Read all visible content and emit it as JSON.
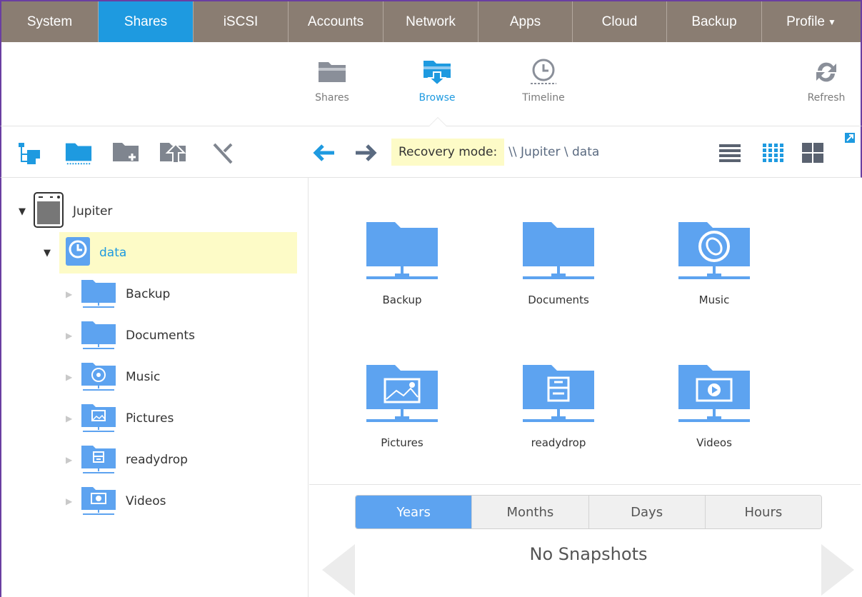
{
  "nav": {
    "tabs": [
      {
        "label": "System"
      },
      {
        "label": "Shares"
      },
      {
        "label": "iSCSI"
      },
      {
        "label": "Accounts"
      },
      {
        "label": "Network"
      },
      {
        "label": "Apps"
      },
      {
        "label": "Cloud"
      },
      {
        "label": "Backup"
      },
      {
        "label": "Profile"
      }
    ],
    "active_tab": "Shares"
  },
  "subnav": {
    "shares": "Shares",
    "browse": "Browse",
    "timeline": "Timeline",
    "refresh": "Refresh"
  },
  "toolbar": {
    "recovery_label": "Recovery mode:",
    "path": "\\\\ Jupiter \\ data"
  },
  "tree": {
    "root": "Jupiter",
    "share": "data",
    "folders": [
      "Backup",
      "Documents",
      "Music",
      "Pictures",
      "readydrop",
      "Videos"
    ]
  },
  "grid": {
    "folders": [
      {
        "label": "Backup",
        "icon": "folder-icon"
      },
      {
        "label": "Documents",
        "icon": "folder-icon"
      },
      {
        "label": "Music",
        "icon": "music-folder-icon"
      },
      {
        "label": "Pictures",
        "icon": "pictures-folder-icon"
      },
      {
        "label": "readydrop",
        "icon": "readydrop-folder-icon"
      },
      {
        "label": "Videos",
        "icon": "videos-folder-icon"
      }
    ]
  },
  "timeline": {
    "segments": [
      "Years",
      "Months",
      "Days",
      "Hours"
    ],
    "active_segment": "Years",
    "empty_text": "No Snapshots"
  },
  "colors": {
    "nav_bg": "#8a7d72",
    "accent": "#1e9ae0",
    "folder": "#5da3f0",
    "highlight": "#fdfbc7"
  }
}
